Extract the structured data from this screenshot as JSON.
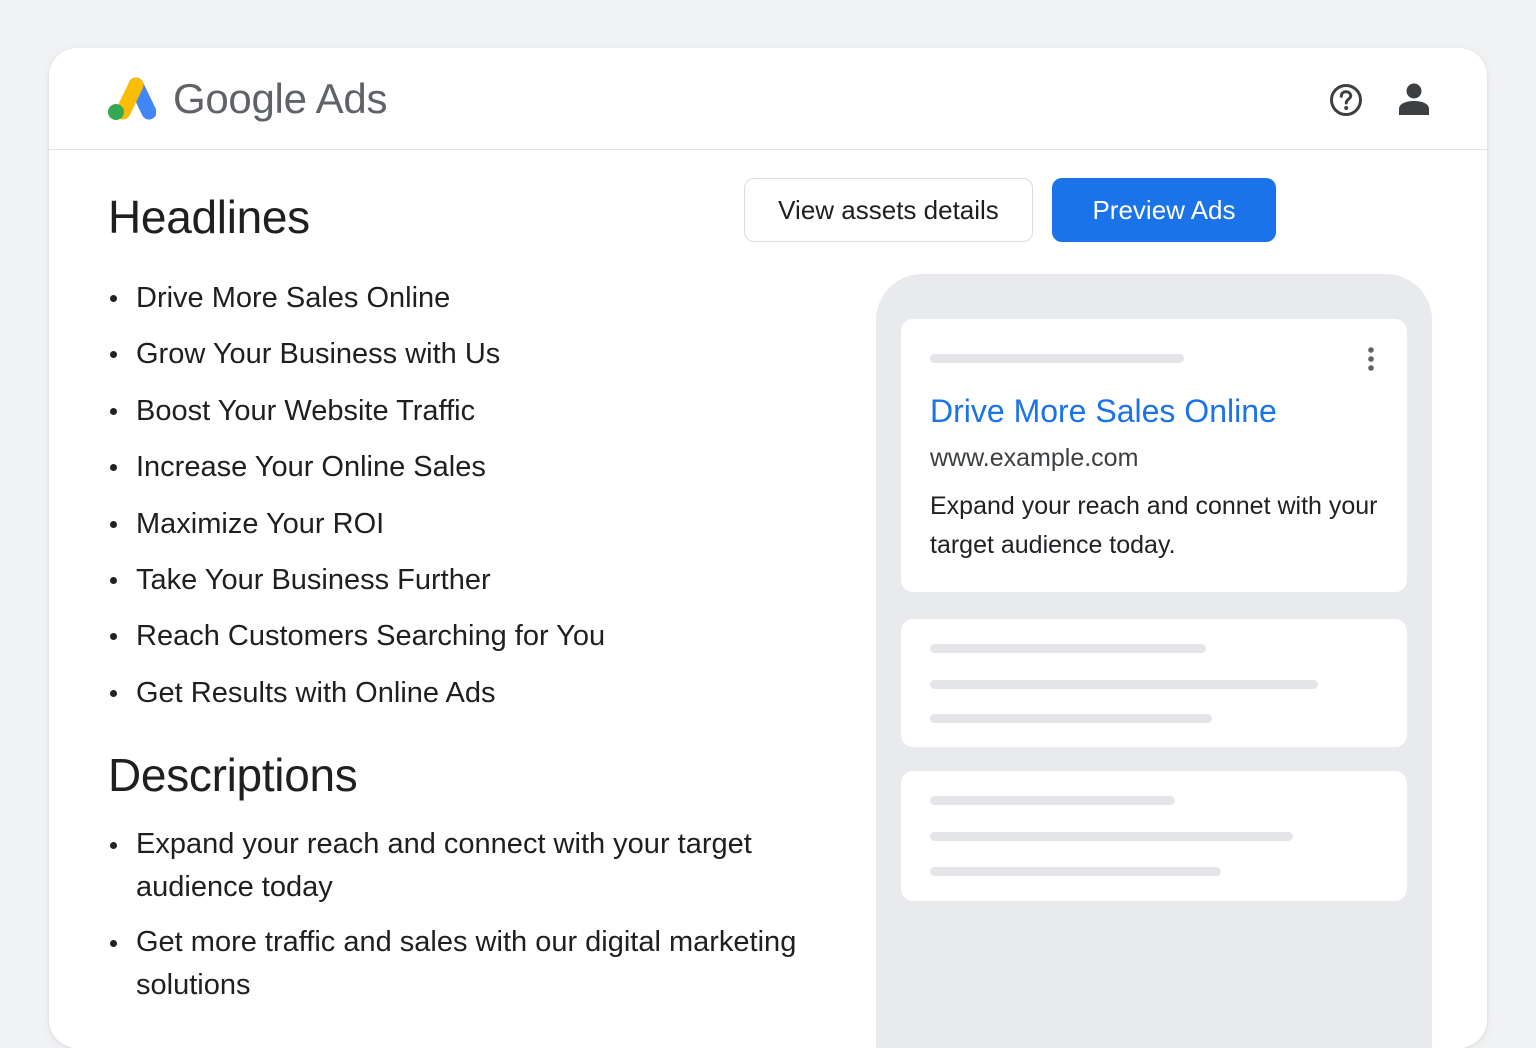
{
  "header": {
    "brand": "Google Ads",
    "logo_icon": "google-ads-logo",
    "help_icon": "help-circle-icon",
    "account_icon": "person-icon"
  },
  "headlines": {
    "title": "Headlines",
    "items": [
      "Drive More Sales Online",
      "Grow Your Business with Us",
      "Boost Your Website Traffic",
      "Increase Your Online Sales",
      "Maximize Your ROI",
      "Take Your Business Further",
      "Reach Customers Searching for You",
      "Get Results with Online Ads"
    ]
  },
  "descriptions": {
    "title": "Descriptions",
    "items": [
      "Expand your reach and connect with your target audience today",
      "Get more traffic and sales with our digital marketing solutions"
    ]
  },
  "actions": {
    "view_assets_label": "View assets details",
    "preview_label": "Preview Ads"
  },
  "preview": {
    "ad": {
      "headline": "Drive More Sales Online",
      "url": "www.example.com",
      "description": "Expand your reach and connet with your target audience today."
    },
    "menu_icon": "more-vert-icon"
  },
  "colors": {
    "primary": "#1a73e8",
    "logo_blue": "#4285f4",
    "logo_yellow": "#fbbc04",
    "logo_green": "#34a853",
    "page_background": "#f1f2f4",
    "phone_background": "#e8eaed"
  }
}
